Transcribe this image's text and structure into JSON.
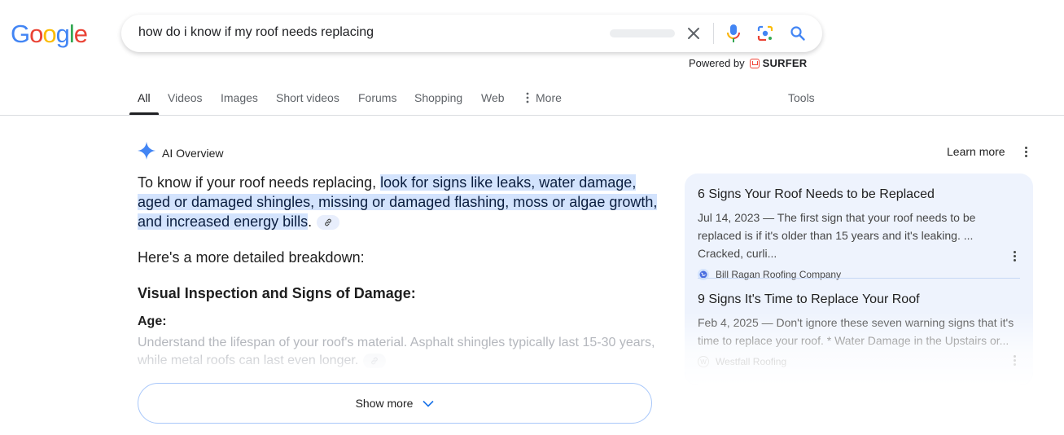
{
  "logo": {
    "letters": [
      "G",
      "o",
      "o",
      "g",
      "l",
      "e"
    ],
    "colors": [
      "#4285F4",
      "#EA4335",
      "#FBBC05",
      "#4285F4",
      "#34A853",
      "#EA4335"
    ]
  },
  "search": {
    "query": "how do i know if my roof needs replacing",
    "icons": [
      "clear-icon",
      "microphone-icon",
      "google-lens-icon",
      "search-icon"
    ]
  },
  "powered_by": {
    "label": "Powered by",
    "brand": "SURFER"
  },
  "tabs": [
    {
      "label": "All",
      "active": true
    },
    {
      "label": "Videos"
    },
    {
      "label": "Images"
    },
    {
      "label": "Short videos"
    },
    {
      "label": "Forums"
    },
    {
      "label": "Shopping"
    },
    {
      "label": "Web"
    },
    {
      "label": "More"
    }
  ],
  "tools_label": "Tools",
  "ai_overview": {
    "title": "AI Overview",
    "learn_more": "Learn more",
    "intro_plain": "To know if your roof needs replacing, ",
    "intro_highlight": "look for signs like leaks, water damage, aged or damaged shingles, missing or damaged flashing, moss or algae growth, and increased energy bills",
    "intro_end": ".",
    "breakdown": "Here's a more detailed breakdown:",
    "section_heading": "Visual Inspection and Signs of Damage:",
    "sub_heading": "Age:",
    "sub_text": "Understand the lifespan of your roof's material. Asphalt shingles typically last 15-30 years, while metal roofs can last even longer.",
    "show_more": "Show more"
  },
  "sources": [
    {
      "title": "6 Signs Your Roof Needs to be Replaced",
      "snippet": "Jul 14, 2023 — The first sign that your roof needs to be replaced is if it's older than 15 years and it's leaking. ... Cracked, curli...",
      "site": "Bill Ragan Roofing Company"
    },
    {
      "title": "9 Signs It's Time to Replace Your Roof",
      "snippet": "Feb 4, 2025 — Don't ignore these seven warning signs that it's time to replace your roof. * Water Damage in the Upstairs or...",
      "site": "Westfall Roofing"
    }
  ]
}
